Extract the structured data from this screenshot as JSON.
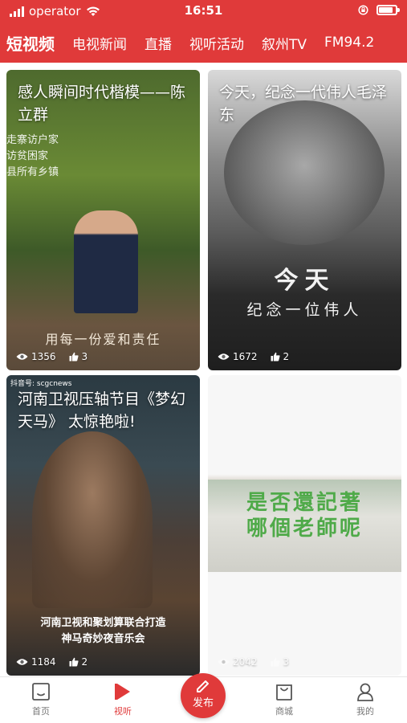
{
  "status_bar": {
    "carrier": "operator",
    "time": "16:51",
    "battery_level_percent": 85
  },
  "nav": {
    "tabs": [
      {
        "label": "短视频",
        "active": true
      },
      {
        "label": "电视新闻",
        "active": false
      },
      {
        "label": "直播",
        "active": false
      },
      {
        "label": "视听活动",
        "active": false
      },
      {
        "label": "叙州TV",
        "active": false
      },
      {
        "label": "FM94.2",
        "active": false
      }
    ]
  },
  "videos": [
    {
      "title": "感人瞬间时代楷模——陈立群",
      "side_text": [
        "走寨访户家",
        "访贫困家",
        "县所有乡镇"
      ],
      "caption": "用每一份爱和责任",
      "views": "1356",
      "likes": "3"
    },
    {
      "title": "今天，纪念一代伟人毛泽东",
      "caption_large": "今天",
      "caption": "纪念一位伟人",
      "views": "1672",
      "likes": "2"
    },
    {
      "title": "河南卫视压轴节目《梦幻天马》 太惊艳啦!",
      "watermark": "抖音号: scgcnews",
      "caption_lines": [
        "河南卫视和聚划算联合打造",
        "神马奇妙夜音乐会"
      ],
      "views": "1184",
      "likes": "2"
    },
    {
      "title": "",
      "caption_lines": [
        "是否還記著",
        "哪個老師呢"
      ],
      "views": "2042",
      "likes": "3"
    }
  ],
  "tabbar": {
    "items": [
      {
        "label": "首页",
        "icon": "home-icon",
        "active": false
      },
      {
        "label": "视听",
        "icon": "play-icon",
        "active": true
      },
      {
        "label": "发布",
        "icon": "pen-icon",
        "active": false
      },
      {
        "label": "商城",
        "icon": "bag-icon",
        "active": false
      },
      {
        "label": "我的",
        "icon": "user-icon",
        "active": false
      }
    ]
  },
  "colors": {
    "accent": "#e03a3a",
    "inactive": "#777777"
  }
}
